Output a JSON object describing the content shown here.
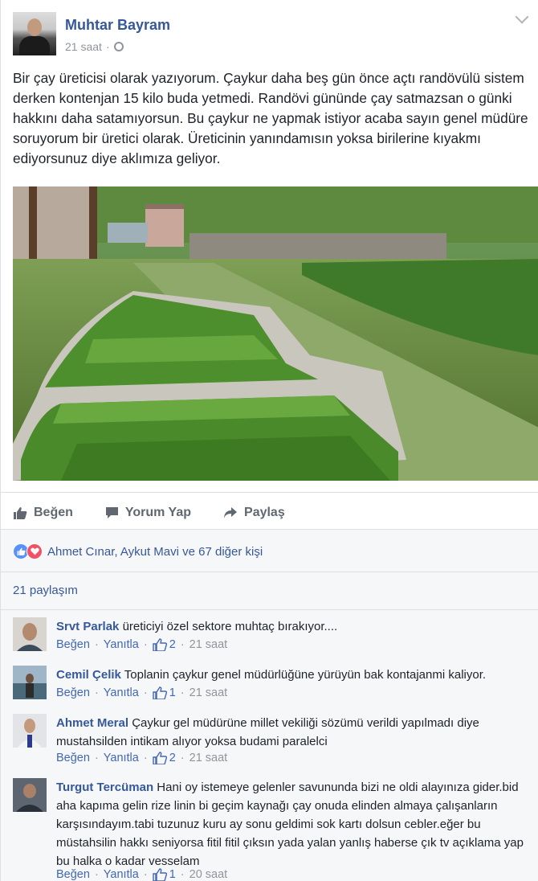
{
  "post": {
    "author": "Muhtar Bayram",
    "time": "21 saat",
    "separator": "·",
    "text": "Bir çay üreticisi olarak yazıyorum. Çaykur daha beş gün önce açtı randövülü sistem derken kontenjan 15 kilo buda yetmedi. Randövi gününde çay satmazsan o günki hakkını daha satamıyorsun. Bu çaykur ne yapmak istiyor acaba sayın genel müdüre soruyorum bir üretici olarak. Üreticinin yanındamısın yoksa birilerine kıyakmı ediyorsunuz diye aklımıza geliyor."
  },
  "actions": {
    "like": "Beğen",
    "comment": "Yorum Yap",
    "share": "Paylaş"
  },
  "reactions": {
    "text": "Ahmet Cınar, Aykut Mavi ve 67 diğer kişi"
  },
  "shares": "21 paylaşım",
  "comments": [
    {
      "name": "Srvt Parlak",
      "text": "üreticiyi özel sektore muhtaç bırakıyor....",
      "like": "Beğen",
      "reply": "Yanıtla",
      "likes": "2",
      "time": "21 saat"
    },
    {
      "name": "Cemil Çelik",
      "text": "Toplanin çaykur genel müdürlüğüne yürüyün bak kontajanmi kaliyor.",
      "like": "Beğen",
      "reply": "Yanıtla",
      "likes": "1",
      "time": "21 saat"
    },
    {
      "name": "Ahmet Meral",
      "text": "Çaykur gel müdürüne millet vekiliği sözümü verildi yapılmadı diye mustahsilden intikam alıyor yoksa budami paralelci",
      "like": "Beğen",
      "reply": "Yanıtla",
      "likes": "2",
      "time": "21 saat"
    },
    {
      "name": "Turgut Tercüman",
      "text": "Hani oy istemeye gelenler savununda bizi ne oldi alayınıza gider.bid aha kapıma gelin rize linin bi geçim kaynağı çay onuda elinden almaya çalışanların karşısındayım.tabi tuzunuz kuru ay sonu geldimi sok kartı dolsun cebler.eğer bu müstahsilin hakkı seniyorsa fitil fitil çıksın yada yalan yanlış haberse çık tv açıklama yap bu halka o kadar vesselam",
      "like": "Beğen",
      "reply": "Yanıtla",
      "likes": "1",
      "time": "20 saat"
    }
  ],
  "colors": {
    "link": "#365899",
    "meta": "#90949c",
    "like_reaction": "#5890ff",
    "love_reaction": "#f25268"
  },
  "icons": [
    "globe-icon",
    "chevron-down-icon",
    "thumbs-up-icon",
    "comment-icon",
    "share-icon",
    "like-reaction-icon",
    "love-reaction-icon"
  ]
}
